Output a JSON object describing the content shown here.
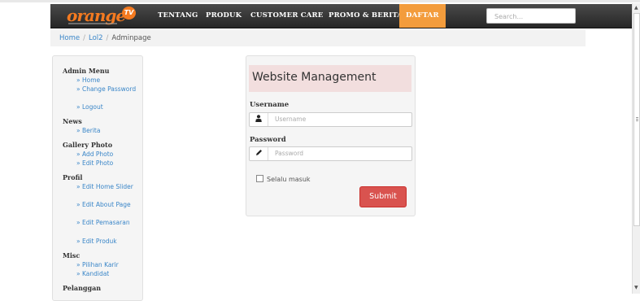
{
  "header": {
    "logo_text": "orange",
    "logo_badge": "TV",
    "nav": [
      "TENTANG",
      "PRODUK",
      "CUSTOMER CARE",
      "PROMO & BERITA",
      "DAFTAR"
    ],
    "search_placeholder": "Search..."
  },
  "breadcrumb": {
    "items": [
      "Home",
      "Lol2",
      "Adminpage"
    ],
    "separator": "/"
  },
  "sidebar": {
    "sections": [
      {
        "title": "Admin Menu",
        "items": [
          "» Home",
          "» Change Password",
          "» Logout"
        ]
      },
      {
        "title": "News",
        "items": [
          "» Berita"
        ]
      },
      {
        "title": "Gallery Photo",
        "items": [
          "» Add Photo",
          "» Edit Photo"
        ]
      },
      {
        "title": "Profil",
        "items": [
          "» Edit Home Slider",
          "» Edit About Page",
          "» Edit Pemasaran",
          "» Edit Produk"
        ]
      },
      {
        "title": "Misc",
        "items": [
          "» Pilihan Karir",
          "» Kandidat"
        ]
      },
      {
        "title": "Pelanggan",
        "items": []
      }
    ]
  },
  "login": {
    "title": "Website Management",
    "username_label": "Username",
    "username_placeholder": "Username",
    "password_label": "Password",
    "password_placeholder": "Password",
    "remember_label": "Selalu masuk",
    "submit_label": "Submit"
  },
  "icons": {
    "user": "user-icon",
    "password": "pencil-icon"
  },
  "colors": {
    "accent": "#f39c3c",
    "brand": "#f47a20",
    "submit": "#d9534f",
    "link": "#3a86c8",
    "heading_bg": "#f2dede"
  }
}
